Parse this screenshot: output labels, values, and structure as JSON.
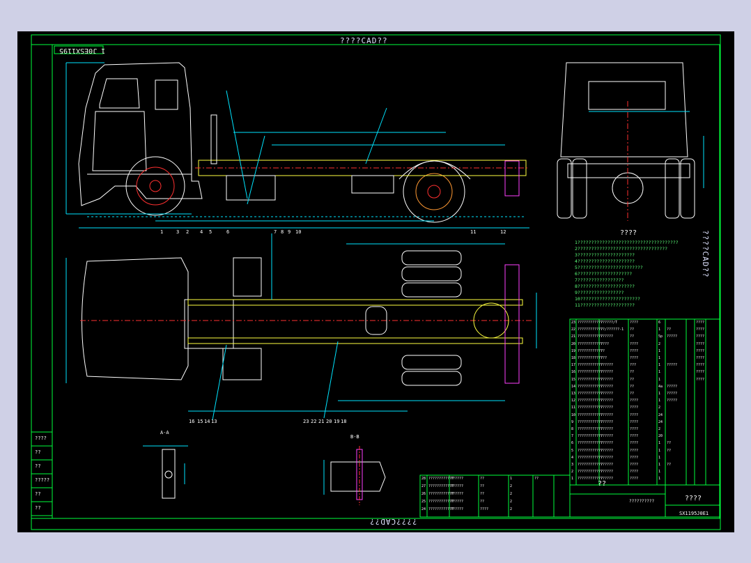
{
  "sheet": {
    "title_top": "????CAD??",
    "title_bottom": "????CAD??",
    "title_right": "????CAD??",
    "drawing_no": "1 J0ESX1195"
  },
  "requirements": {
    "heading": "????",
    "lines": [
      "1?????????????????????????????????????",
      "2?????????????????????????????????",
      "3?????????????????????",
      "4?????????????????????",
      "5????????????????????????",
      "6????????????????????",
      "7?????????????????",
      "8?????????????????????",
      "9?????????????????",
      "10??????????????????????",
      "11????????????????????"
    ]
  },
  "balloons_top": [
    "1",
    "3",
    "2",
    "4",
    "5",
    "6",
    "7",
    "8",
    "9",
    "10",
    "11",
    "12"
  ],
  "balloons_bottom": [
    "16",
    "15",
    "14",
    "13",
    "23",
    "22",
    "21",
    "20",
    "19",
    "18"
  ],
  "section_labels": {
    "aa": "A-A",
    "bb": "B-B"
  },
  "parts_table": {
    "rows": [
      [
        "23",
        "????????????",
        "??????/T",
        "????",
        "6",
        "",
        "",
        "????"
      ],
      [
        "22",
        "????????????",
        "??/??????-1",
        "??",
        "1",
        "??",
        "",
        "????"
      ],
      [
        "21",
        "????????????",
        "??????",
        "??",
        "5p",
        "?????",
        "",
        "????"
      ],
      [
        "20",
        "????????????",
        "????",
        "????",
        "2",
        "",
        "",
        "????"
      ],
      [
        "19",
        "????????????",
        "??",
        "????",
        "1",
        "",
        "",
        "????"
      ],
      [
        "18",
        "????????????",
        "???",
        "????",
        "1",
        "",
        "",
        "????"
      ],
      [
        "17",
        "????????????",
        "??????",
        "???",
        "1",
        "?????",
        "",
        "????"
      ],
      [
        "16",
        "????????????",
        "??????",
        "??",
        "1",
        "",
        "",
        "????"
      ],
      [
        "15",
        "????????????",
        "??????",
        "??",
        "1",
        "",
        "",
        "????"
      ],
      [
        "14",
        "????????????",
        "??????",
        "??",
        "4a",
        "?????",
        "",
        ""
      ],
      [
        "13",
        "????????????",
        "??????",
        "??",
        "1",
        "?????",
        "",
        ""
      ],
      [
        "12",
        "????????????",
        "??????",
        "????",
        "1",
        "?????",
        "",
        ""
      ],
      [
        "11",
        "????????????",
        "??????",
        "????",
        "2",
        "",
        "",
        ""
      ],
      [
        "10",
        "????????????",
        "??????",
        "????",
        "24",
        "",
        "",
        ""
      ],
      [
        "9",
        "????????????",
        "??????",
        "????",
        "24",
        "",
        "",
        ""
      ],
      [
        "8",
        "????????????",
        "??????",
        "????",
        "2",
        "",
        "",
        ""
      ],
      [
        "7",
        "????????????",
        "??????",
        "????",
        "20",
        "",
        "",
        ""
      ],
      [
        "6",
        "????????????",
        "??????",
        "????",
        "1",
        "??",
        "",
        ""
      ],
      [
        "5",
        "????????????",
        "??????",
        "????",
        "1",
        "??",
        "",
        ""
      ],
      [
        "4",
        "????????????",
        "??????",
        "????",
        "1",
        "",
        "",
        ""
      ],
      [
        "3",
        "????????????",
        "??????",
        "????",
        "1",
        "??",
        "",
        ""
      ],
      [
        "2",
        "????????????",
        "??????",
        "????",
        "1",
        "",
        "",
        ""
      ],
      [
        "1",
        "????????????",
        "??????",
        "????",
        "1",
        "",
        "",
        ""
      ]
    ]
  },
  "parts_table_lower": {
    "rows": [
      [
        "28",
        "????????????",
        "??????",
        "??",
        "1",
        "??",
        "",
        ""
      ],
      [
        "27",
        "????????????",
        "??????",
        "??",
        "2",
        "",
        "",
        ""
      ],
      [
        "26",
        "????????????",
        "??????",
        "??",
        "2",
        "",
        "",
        ""
      ],
      [
        "25",
        "????????????",
        "??????",
        "??",
        "2",
        "",
        "",
        ""
      ],
      [
        "24",
        "????????????",
        "??????",
        "????",
        "2",
        "",
        "",
        ""
      ]
    ]
  },
  "title_block": {
    "name": "??",
    "code": "??????????",
    "title": "????",
    "drawing_no": "SX1195J0E1"
  },
  "revision_block": {
    "rows": [
      "????",
      "??",
      "??",
      "?????",
      "??",
      "??"
    ]
  },
  "colors": {
    "frame": "#00ff3c",
    "dimension": "#00e5ff",
    "outline": "#ffffff",
    "centerline": "#ff3030",
    "accent_magenta": "#ff40ff",
    "accent_yellow": "#ffff40",
    "text_green": "#5cff7a"
  }
}
